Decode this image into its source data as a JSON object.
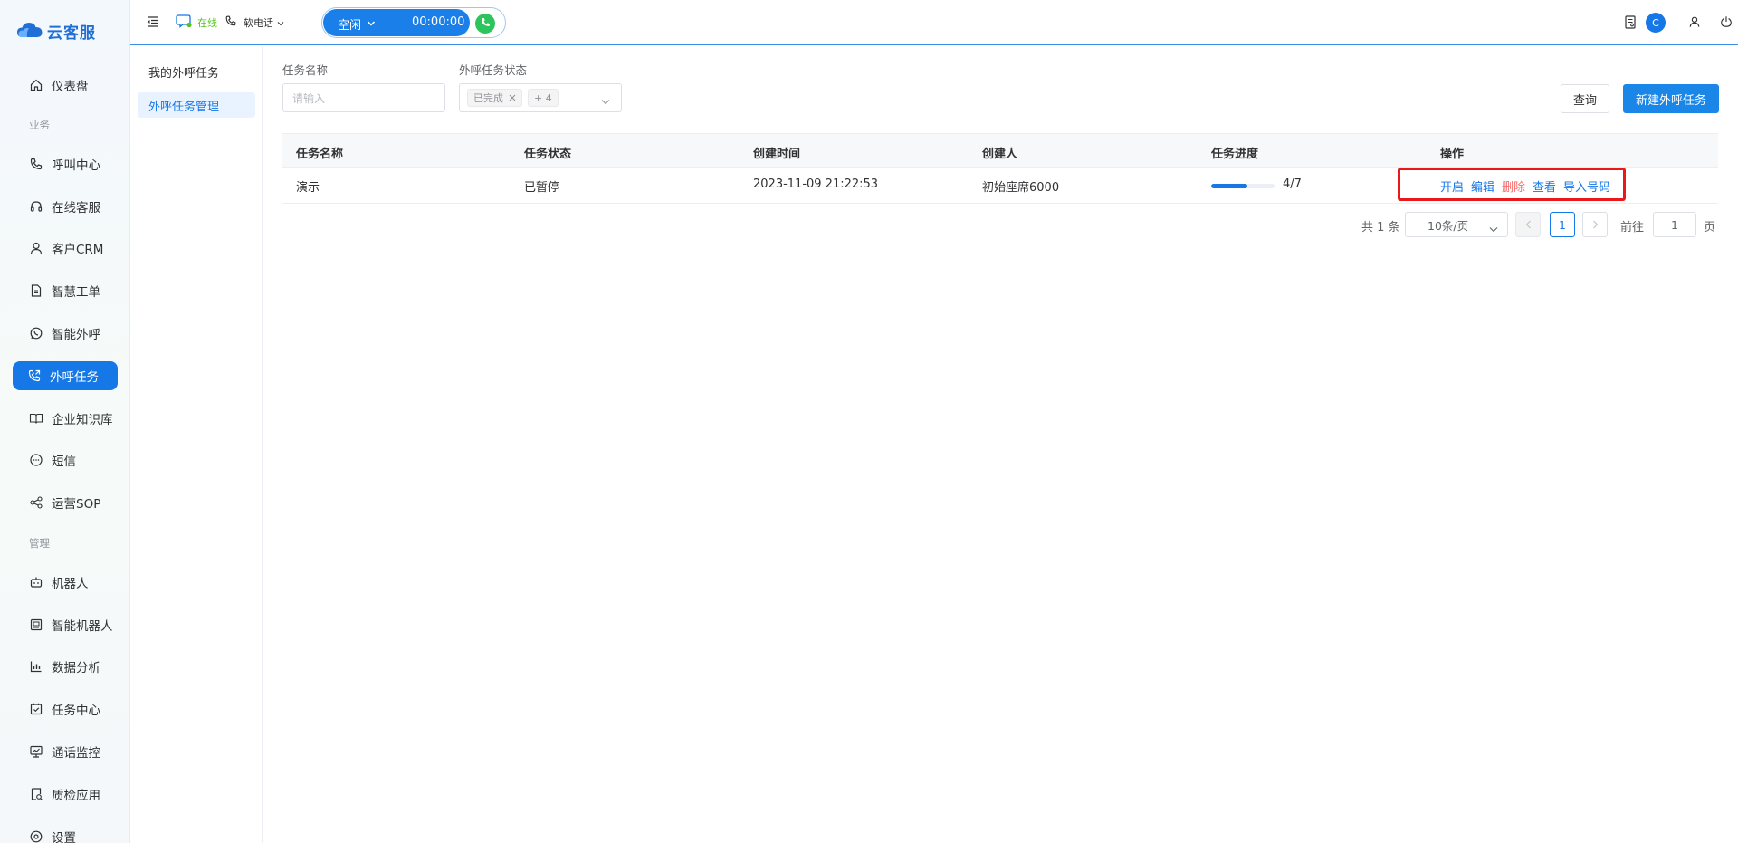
{
  "sidebar": {
    "logo_text": "云客服",
    "items": [
      {
        "label": "仪表盘",
        "icon": "home-icon"
      },
      {
        "label": "呼叫中心",
        "icon": "phone-icon"
      },
      {
        "label": "在线客服",
        "icon": "headset-icon"
      },
      {
        "label": "客户CRM",
        "icon": "user-icon"
      },
      {
        "label": "智慧工单",
        "icon": "document-icon"
      },
      {
        "label": "智能外呼",
        "icon": "whatsapp-icon"
      },
      {
        "label": "外呼任务",
        "icon": "phone-forward-icon"
      },
      {
        "label": "企业知识库",
        "icon": "book-icon"
      },
      {
        "label": "短信",
        "icon": "chat-bubble-icon"
      },
      {
        "label": "运营SOP",
        "icon": "share-nodes-icon"
      },
      {
        "label": "机器人",
        "icon": "robot-icon"
      },
      {
        "label": "智能机器人",
        "icon": "smart-robot-icon"
      },
      {
        "label": "数据分析",
        "icon": "bar-chart-icon"
      },
      {
        "label": "任务中心",
        "icon": "task-check-icon"
      },
      {
        "label": "通话监控",
        "icon": "monitor-icon"
      },
      {
        "label": "质检应用",
        "icon": "quality-check-icon"
      },
      {
        "label": "设置",
        "icon": "gear-icon"
      }
    ],
    "groups": {
      "business": "业务",
      "manage": "管理"
    }
  },
  "topbar": {
    "online_status": "在线",
    "softphone_label": "软电话",
    "call_status": "空闲",
    "timer": "00:00:00",
    "avatar_letter": "C"
  },
  "submenu": {
    "items": [
      "我的外呼任务",
      "外呼任务管理"
    ]
  },
  "filters": {
    "task_name_label": "任务名称",
    "task_name_placeholder": "请输入",
    "task_status_label": "外呼任务状态",
    "selected_tag": "已完成",
    "more_tag": "+ 4",
    "query_button": "查询",
    "create_button": "新建外呼任务"
  },
  "table": {
    "headers": [
      "任务名称",
      "任务状态",
      "创建时间",
      "创建人",
      "任务进度",
      "操作"
    ],
    "rows": [
      {
        "name": "演示",
        "status": "已暂停",
        "created_at": "2023-11-09 21:22:53",
        "creator": "初始座席6000",
        "progress_text": "4/7",
        "progress_fraction": 0.5714,
        "actions": {
          "start": "开启",
          "edit": "编辑",
          "delete": "删除",
          "view": "查看",
          "import": "导入号码"
        }
      }
    ]
  },
  "pagination": {
    "total_text": "共 1 条",
    "page_size": "10条/页",
    "current_page": "1",
    "goto_label": "前往",
    "goto_value": "1",
    "page_suffix": "页"
  },
  "colors": {
    "primary": "#1677e6",
    "danger": "#f56c6c",
    "highlight": "#e8181b",
    "online": "#52c41a"
  }
}
